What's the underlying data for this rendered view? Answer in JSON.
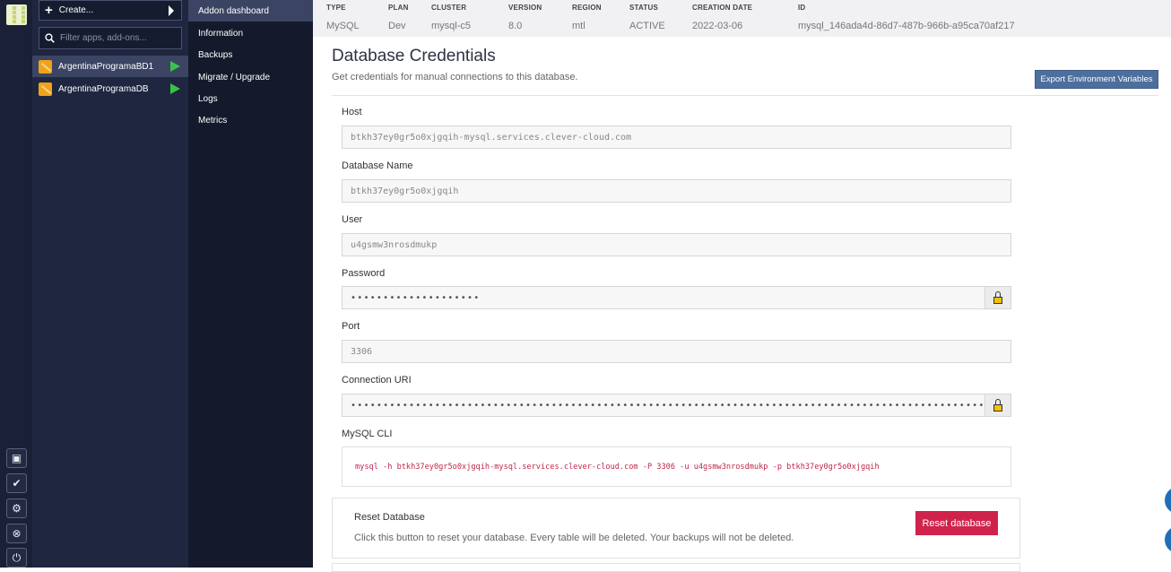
{
  "rail": {
    "logo": "clever-cloud-logo",
    "buttons": [
      {
        "name": "console-icon",
        "glyph": "▣"
      },
      {
        "name": "status-check-icon",
        "glyph": "✔"
      },
      {
        "name": "settings-gear-icon",
        "glyph": "⚙"
      },
      {
        "name": "help-lifebuoy-icon",
        "glyph": "⊗"
      },
      {
        "name": "logout-power-icon",
        "glyph": "⏻"
      }
    ]
  },
  "apps": {
    "create_label": "Create...",
    "filter_placeholder": "Filter apps, add-ons...",
    "items": [
      {
        "label": "ArgentinaProgramaBD1",
        "active": true
      },
      {
        "label": "ArgentinaProgramaDB",
        "active": false
      }
    ]
  },
  "menu": {
    "items": [
      {
        "label": "Addon dashboard",
        "active": true
      },
      {
        "label": "Information"
      },
      {
        "label": "Backups"
      },
      {
        "label": "Migrate / Upgrade"
      },
      {
        "label": "Logs"
      },
      {
        "label": "Metrics"
      }
    ]
  },
  "info": {
    "type": {
      "head": "TYPE",
      "value": "MySQL"
    },
    "plan": {
      "head": "PLAN",
      "value": "Dev"
    },
    "cluster": {
      "head": "CLUSTER",
      "value": "mysql-c5"
    },
    "version": {
      "head": "VERSION",
      "value": "8.0"
    },
    "region": {
      "head": "REGION",
      "value": "mtl"
    },
    "status": {
      "head": "STATUS",
      "value": "ACTIVE"
    },
    "created": {
      "head": "CREATION DATE",
      "value": "2022-03-06"
    },
    "id": {
      "head": "ID",
      "value": "mysql_146ada4d-86d7-487b-966b-a95ca70af217"
    }
  },
  "page": {
    "title": "Database Credentials",
    "subtitle": "Get credentials for manual connections to this database.",
    "export_label": "Export Environment Variables"
  },
  "fields": {
    "host": {
      "label": "Host",
      "value": "btkh37ey0gr5o0xjgqih-mysql.services.clever-cloud.com"
    },
    "dbname": {
      "label": "Database Name",
      "value": "btkh37ey0gr5o0xjgqih"
    },
    "user": {
      "label": "User",
      "value": "u4gsmw3nrosdmukp"
    },
    "password": {
      "label": "Password",
      "value": "••••••••••••••••••••"
    },
    "port": {
      "label": "Port",
      "value": "3306"
    },
    "uri": {
      "label": "Connection URI",
      "value": "•••••••••••••••••••••••••••••••••••••••••••••••••••••••••••••••••••••••••••••••••••••••••••••••••••"
    },
    "cli": {
      "label": "MySQL CLI",
      "value": "mysql -h btkh37ey0gr5o0xjgqih-mysql.services.clever-cloud.com -P 3306 -u u4gsmw3nrosdmukp -p btkh37ey0gr5o0xjgqih"
    }
  },
  "reset": {
    "title": "Reset Database",
    "description": "Click this button to reset your database. Every table will be deleted. Your backups will not be deleted.",
    "button_label": "Reset database"
  },
  "colors": {
    "sidebar": "#1f2640",
    "active_item": "#3b4463",
    "accent_blue": "#4d6f9d",
    "danger": "#d0234b",
    "cli_text": "#c0254d"
  }
}
